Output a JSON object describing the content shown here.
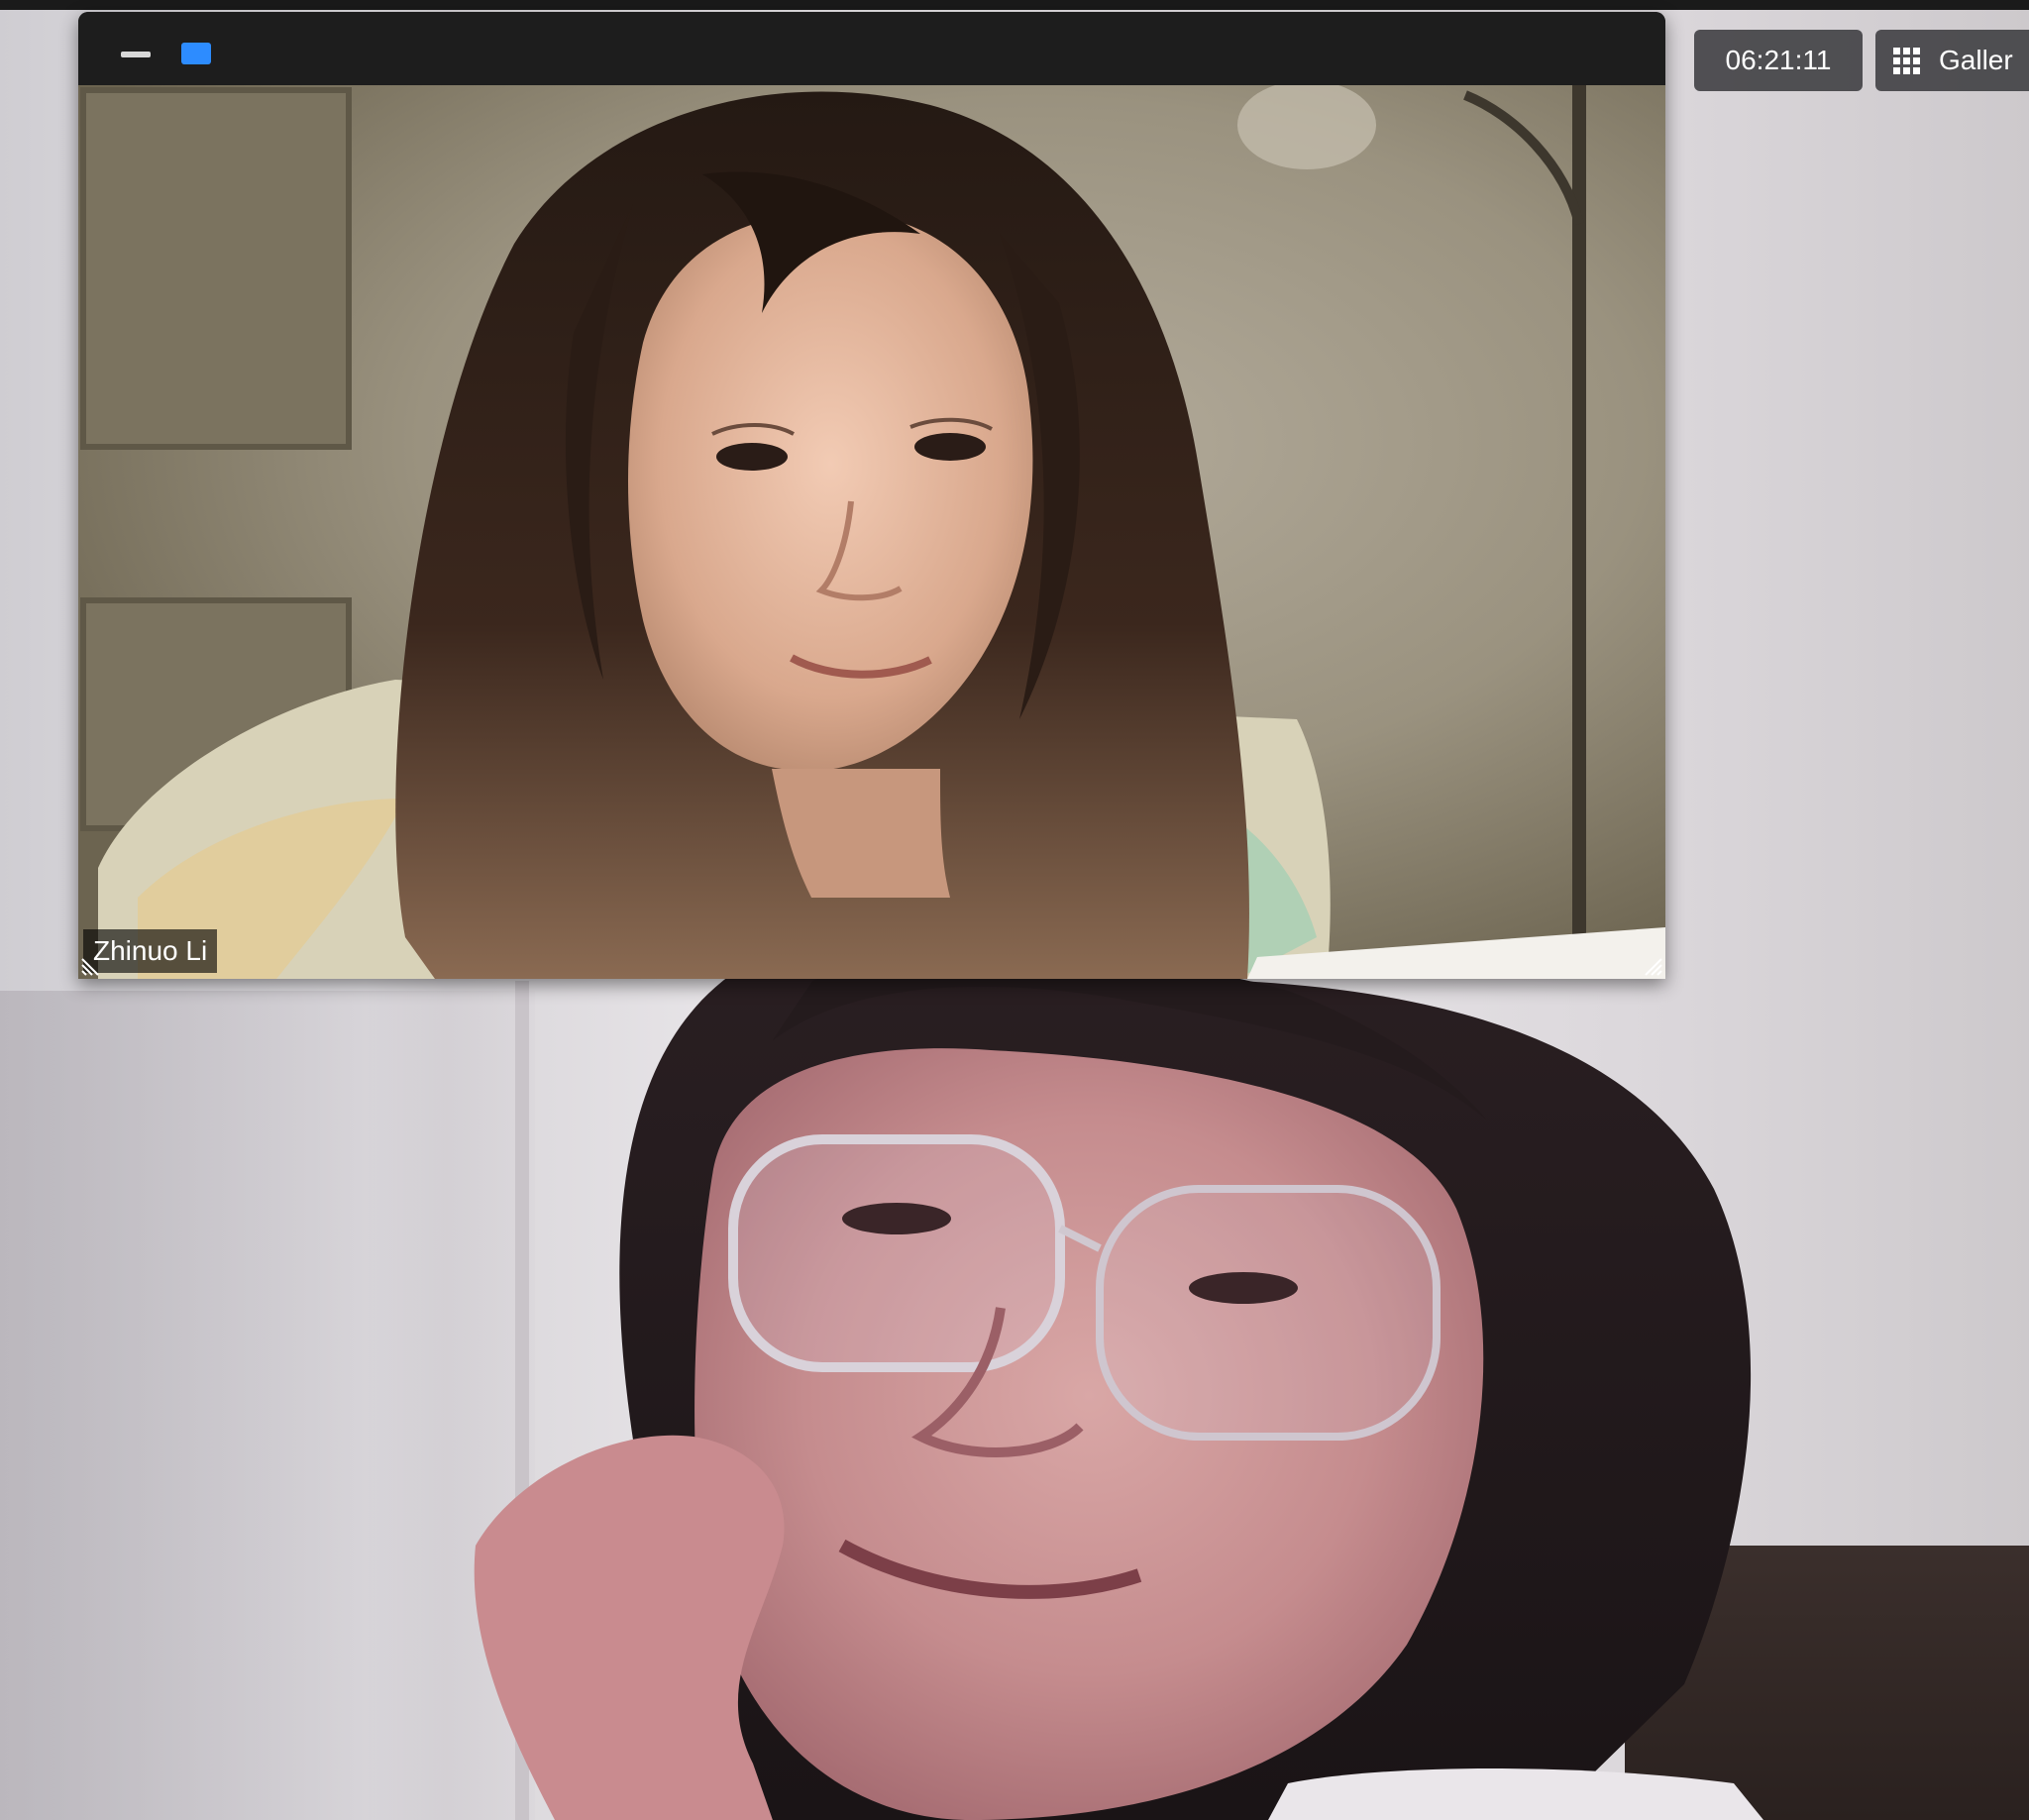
{
  "meeting": {
    "elapsed_time": "06:21:11",
    "view_button_label": "Galler",
    "view_button_icon": "grid-icon"
  },
  "floating_window": {
    "participant_name": "Zhinuo Li",
    "minimize_icon": "minimize-icon",
    "view_toggle_icon": "view-toggle-icon",
    "accent_color": "#2d8cff"
  },
  "main_video": {
    "participant_name": ""
  },
  "colors": {
    "titlebar": "#1d1d1d",
    "chip_background": "#3c3c40",
    "name_tag_background": "#000000"
  }
}
